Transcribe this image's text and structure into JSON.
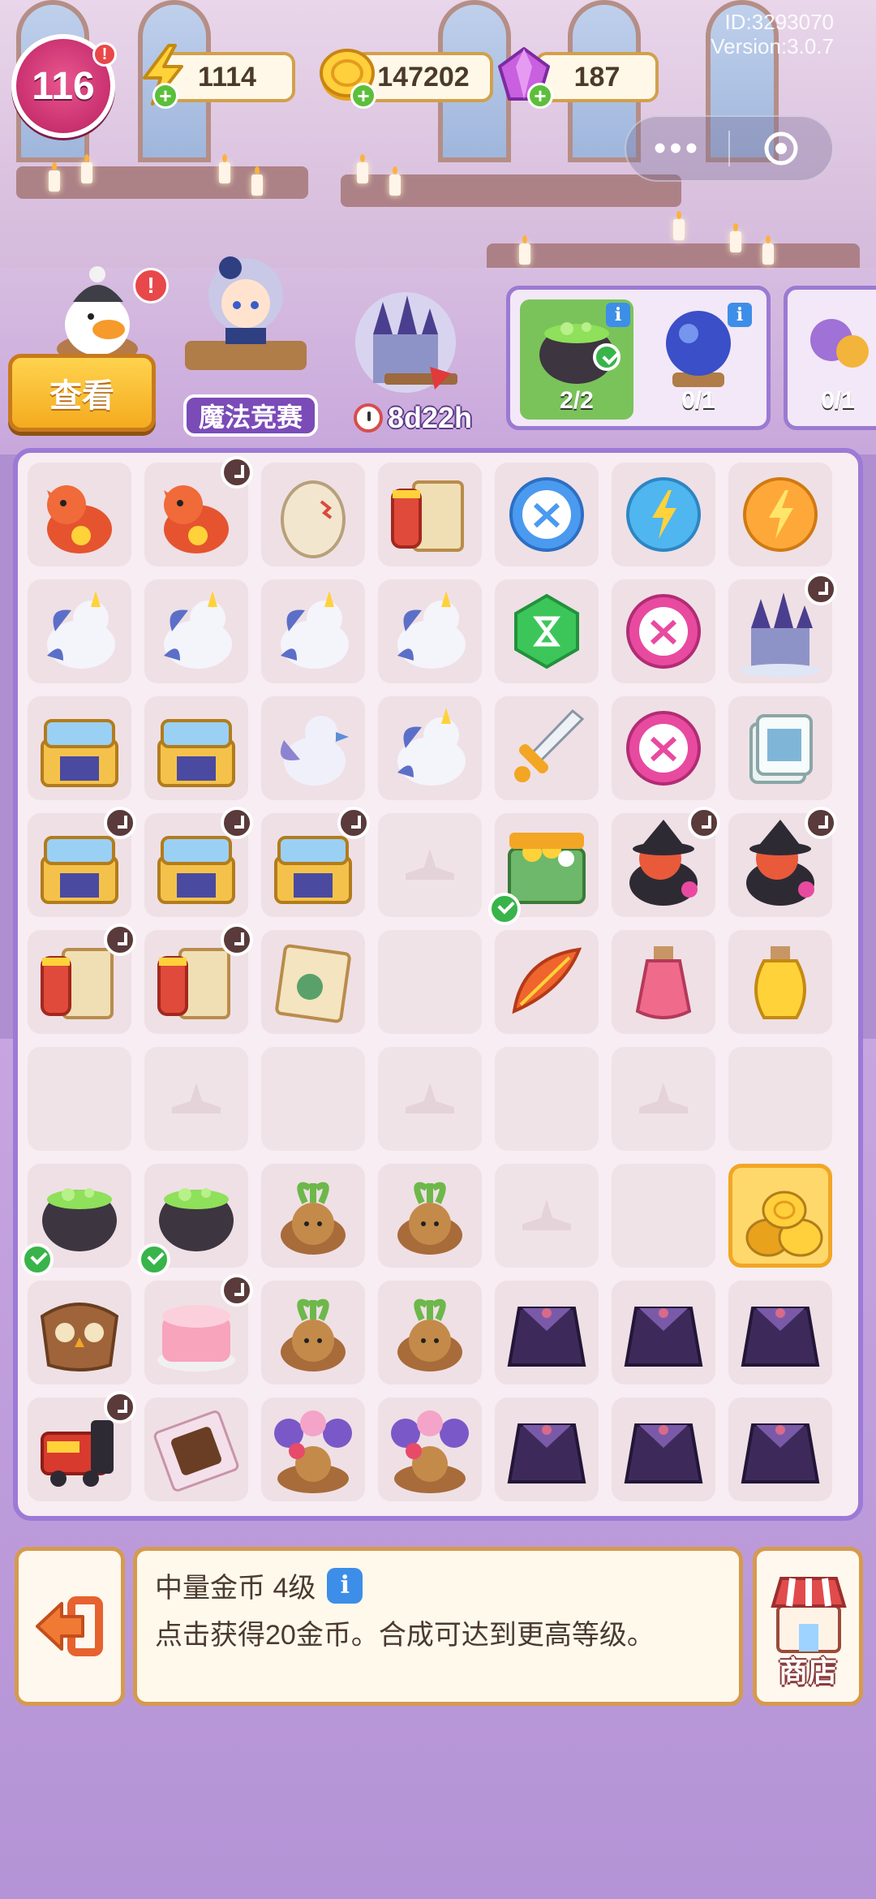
{
  "status": {
    "id_text": "ID:3293070",
    "version_text": "Version:3.0.7",
    "level": "116",
    "level_alert": "!",
    "energy": "1114",
    "coins": "147202",
    "gems": "187"
  },
  "header": {
    "view_button": "查看",
    "event_label": "魔法竞赛",
    "event_timer": "8d22h"
  },
  "orders": [
    {
      "name": "cauldron-order",
      "count": "2/2"
    },
    {
      "name": "crystal-ball-order",
      "count": "0/1"
    },
    {
      "name": "flower-order",
      "count": "0/1"
    }
  ],
  "board": {
    "rows": [
      [
        "dragon",
        "dragon-timer",
        "egg",
        "scroll",
        "scissors-bubble",
        "energy-bubble-blue",
        "energy-bubble-orange"
      ],
      [
        "unicorn",
        "unicorn",
        "unicorn",
        "unicorn",
        "hourglass-gem",
        "scissors-bubble-pink",
        "castle-timer"
      ],
      [
        "chest",
        "chest",
        "griffin",
        "unicorn",
        "sword",
        "scissors-bubble-pink",
        "ticket"
      ],
      [
        "chest-timer",
        "chest-timer",
        "chest-timer",
        "empty-hat",
        "treasure-chest-check",
        "witch-cauldron-timer",
        "witch-cauldron-timer"
      ],
      [
        "scroll-timer",
        "scroll-timer",
        "map-scroll",
        "empty",
        "phoenix-feather",
        "potion-pink",
        "potion-yellow"
      ],
      [
        "empty",
        "empty-hat",
        "empty",
        "empty-hat",
        "empty",
        "empty-hat",
        "empty"
      ],
      [
        "cauldron-check",
        "cauldron-check",
        "mandrake",
        "mandrake",
        "empty-hat",
        "empty",
        "coins-selected"
      ],
      [
        "owl-bag",
        "birthday-cake-timer",
        "mandrake",
        "mandrake",
        "robe",
        "robe",
        "robe"
      ],
      [
        "train-timer",
        "chocolate",
        "mandrake-flower",
        "mandrake-flower",
        "robe",
        "robe",
        "robe"
      ]
    ]
  },
  "info": {
    "title": "中量金币 4级",
    "description": "点击获得20金币。合成可达到更高等级。"
  },
  "shop": {
    "label": "商店"
  },
  "colors": {
    "board_border": "#9c7ad6",
    "accent_gold": "#f4ab1f",
    "level_pink": "#c8306e"
  }
}
